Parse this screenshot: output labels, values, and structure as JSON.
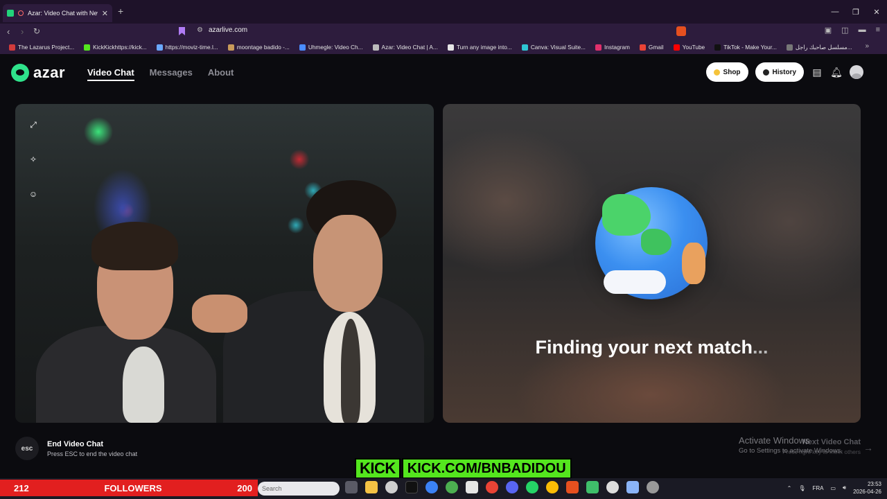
{
  "browser": {
    "tab_title": "Azar: Video Chat with New P...",
    "url": "azarlive.com",
    "bookmarks": [
      {
        "label": "The Lazarus Project...",
        "color": "#d23b3b"
      },
      {
        "label": "KickKickhttps://kick...",
        "color": "#54e61e"
      },
      {
        "label": "https://moviz-time.l...",
        "color": "#6aa9ff"
      },
      {
        "label": "moontage badido -...",
        "color": "#c89a5a"
      },
      {
        "label": "Uhmegle: Video Ch...",
        "color": "#4a8cff"
      },
      {
        "label": "Azar: Video Chat | A...",
        "color": "#bbbbbb"
      },
      {
        "label": "Turn any image into...",
        "color": "#e6e6e6"
      },
      {
        "label": "Canva: Visual Suite...",
        "color": "#2ec5d3"
      },
      {
        "label": "Instagram",
        "color": "#e1306c"
      },
      {
        "label": "Gmail",
        "color": "#ea4335"
      },
      {
        "label": "YouTube",
        "color": "#ff0000"
      },
      {
        "label": "TikTok - Make Your...",
        "color": "#111111"
      },
      {
        "label": "مسلسل صاحبك راجل...",
        "color": "#777777"
      }
    ]
  },
  "site": {
    "logo_text": "azar",
    "nav": {
      "video_chat": "Video Chat",
      "messages": "Messages",
      "about": "About"
    },
    "shop_label": "Shop",
    "history_label": "History",
    "finding_text": "Finding your next match",
    "finding_dots": "...",
    "end": {
      "key": "esc",
      "title": "End Video Chat",
      "subtitle": "Press ESC to end the video chat"
    },
    "next": {
      "title": "Next Video Chat",
      "subtitle": "Press right key to meet others"
    }
  },
  "overlay": {
    "activate_title": "Activate Windows",
    "activate_sub": "Go to Settings to activate Windows.",
    "kick_logo": "KICK",
    "kick_url": "KICK.COM/BNBADIDOU",
    "followers_count": "212",
    "followers_label": "FOLLOWERS",
    "followers_goal": "200"
  },
  "taskbar": {
    "search_placeholder": "Search",
    "lang": "FRA",
    "time": "23:53",
    "date": "2026-04-26"
  },
  "colors": {
    "brand": "#2fe38b",
    "kick": "#54e61e",
    "followers_bar": "#e21f1f"
  }
}
